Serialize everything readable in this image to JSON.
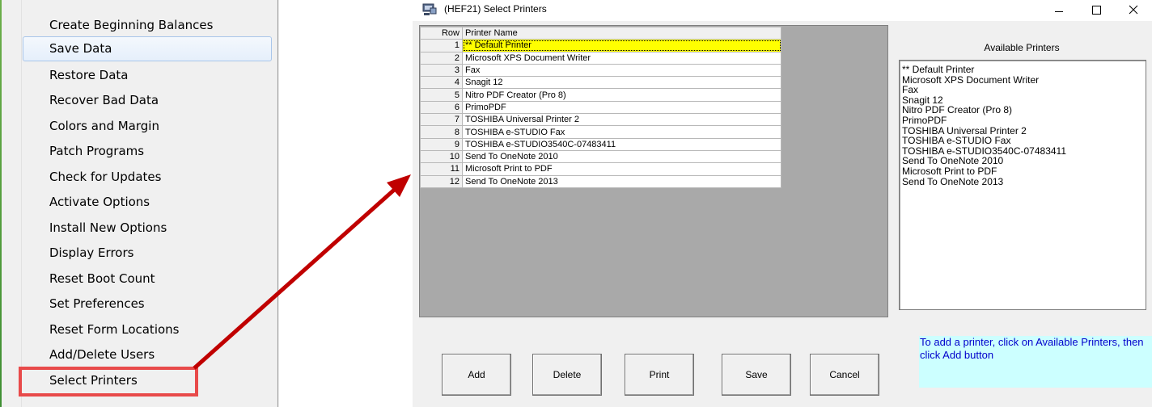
{
  "menu": {
    "items": [
      {
        "label": "Create Beginning Balances"
      },
      {
        "label": "Save Data"
      },
      {
        "label": "Restore Data"
      },
      {
        "label": "Recover Bad Data"
      },
      {
        "label": "Colors and Margin"
      },
      {
        "label": "Patch Programs"
      },
      {
        "label": "Check for Updates"
      },
      {
        "label": "Activate Options"
      },
      {
        "label": "Install New Options"
      },
      {
        "label": "Display Errors"
      },
      {
        "label": "Reset Boot Count"
      },
      {
        "label": "Set Preferences"
      },
      {
        "label": "Reset Form Locations"
      },
      {
        "label": "Add/Delete Users"
      },
      {
        "label": "Select Printers"
      }
    ],
    "hovered_item": "Save Data",
    "highlighted_item": "Select Printers"
  },
  "colors": {
    "highlight_box": "#e84a4a",
    "arrow": "#c00000",
    "selected_row": "#ffff00",
    "hint_background": "#ccffff",
    "hint_text": "#0000cc"
  },
  "dialog": {
    "title": "(HEF21)  Select Printers",
    "app_icon": "app-icon",
    "window_controls": {
      "minimize": "minimize-icon",
      "maximize": "maximize-icon",
      "close": "close-icon"
    },
    "grid": {
      "headers": {
        "row": "Row",
        "name": "Printer Name"
      },
      "rows": [
        {
          "row": "1",
          "name": "** Default Printer"
        },
        {
          "row": "2",
          "name": "Microsoft XPS Document Writer"
        },
        {
          "row": "3",
          "name": "Fax"
        },
        {
          "row": "4",
          "name": "Snagit 12"
        },
        {
          "row": "5",
          "name": "Nitro PDF Creator (Pro 8)"
        },
        {
          "row": "6",
          "name": "PrimoPDF"
        },
        {
          "row": "7",
          "name": "TOSHIBA Universal Printer 2"
        },
        {
          "row": "8",
          "name": "TOSHIBA e-STUDIO Fax"
        },
        {
          "row": "9",
          "name": "TOSHIBA e-STUDIO3540C-07483411"
        },
        {
          "row": "10",
          "name": "Send To OneNote 2010"
        },
        {
          "row": "11",
          "name": "Microsoft Print to PDF"
        },
        {
          "row": "12",
          "name": "Send To OneNote 2013"
        }
      ],
      "selected_row": "1"
    },
    "available": {
      "label": "Available Printers",
      "items": [
        "** Default Printer",
        "Microsoft XPS Document Writer",
        "Fax",
        "Snagit 12",
        "Nitro PDF Creator (Pro 8)",
        "PrimoPDF",
        "TOSHIBA Universal Printer 2",
        "TOSHIBA e-STUDIO Fax",
        "TOSHIBA e-STUDIO3540C-07483411",
        "Send To OneNote 2010",
        "Microsoft Print to PDF",
        "Send To OneNote 2013"
      ]
    },
    "buttons": {
      "add": "Add",
      "delete": "Delete",
      "print": "Print",
      "save": "Save",
      "cancel": "Cancel"
    },
    "hint": "To add a printer, click on Available Printers, then click Add button"
  }
}
